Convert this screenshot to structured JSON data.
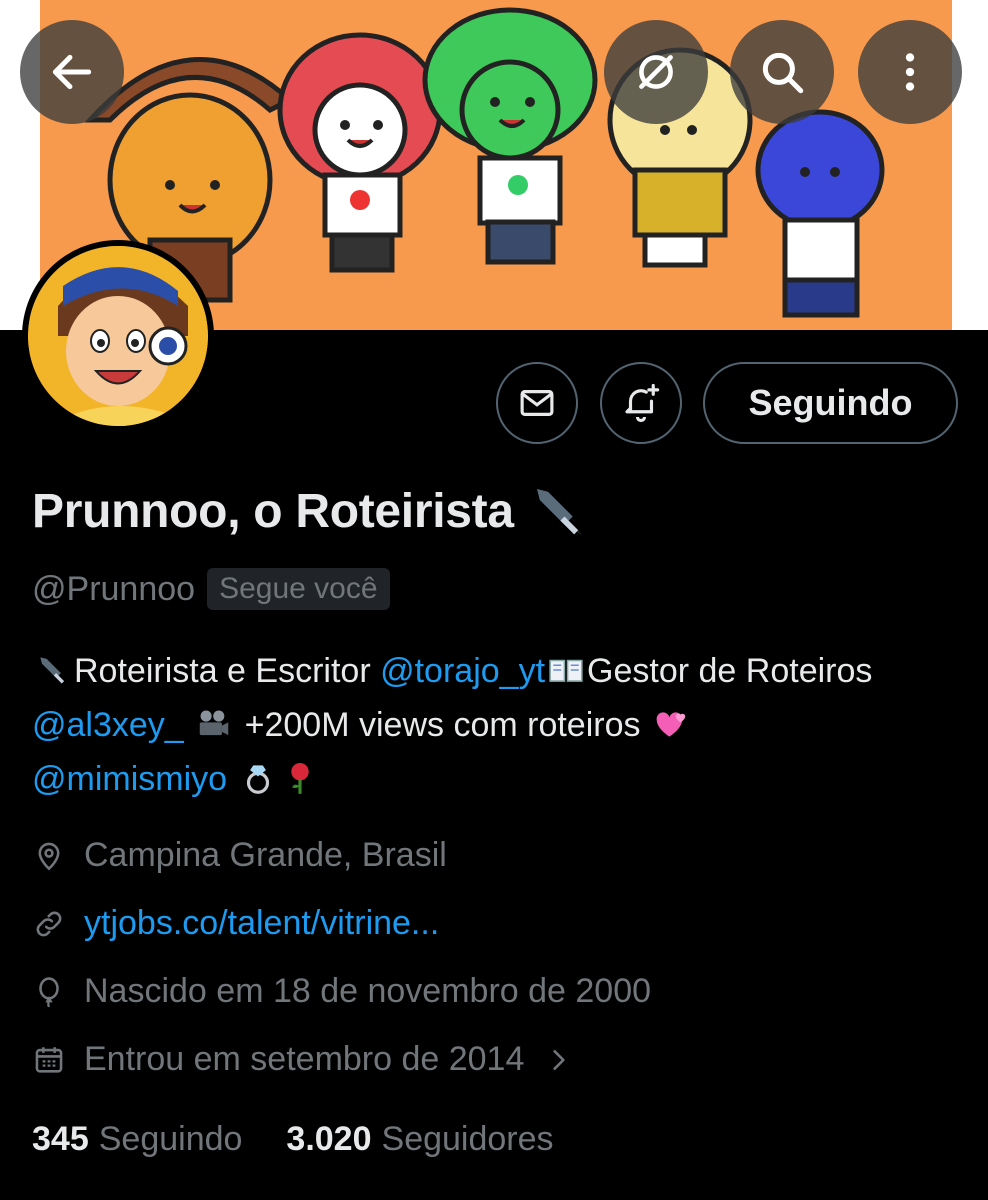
{
  "header": {
    "back_icon": "arrow-left-icon",
    "grok_icon": "grok-icon",
    "search_icon": "search-icon",
    "more_icon": "more-vertical-icon"
  },
  "banner": {
    "background_color": "#f79a4e"
  },
  "actions": {
    "message_icon": "mail-icon",
    "notify_icon": "bell-plus-icon",
    "follow_label": "Seguindo"
  },
  "profile": {
    "display_name": "Prunnoo, o Roteirista",
    "handle": "@Prunnoo",
    "follows_you": "Segue você",
    "bio": {
      "part1": "Roteirista e Escritor",
      "mention1": "@torajo_yt",
      "part2": "Gestor de",
      "part3": "Roteiros",
      "mention2": "@al3xey_",
      "part4": "+200M views com roteiros",
      "mention3": "@mimismiyo"
    },
    "location": "Campina Grande, Brasil",
    "website": "ytjobs.co/talent/vitrine...",
    "birthday": "Nascido em 18 de novembro de 2000",
    "joined": "Entrou em setembro de 2014"
  },
  "stats": {
    "following_count": "345",
    "following_label": "Seguindo",
    "followers_count": "3.020",
    "followers_label": "Seguidores"
  },
  "colors": {
    "accent": "#1d9bf0",
    "muted": "#71767b",
    "text": "#e7e9ea",
    "border": "#536471"
  }
}
